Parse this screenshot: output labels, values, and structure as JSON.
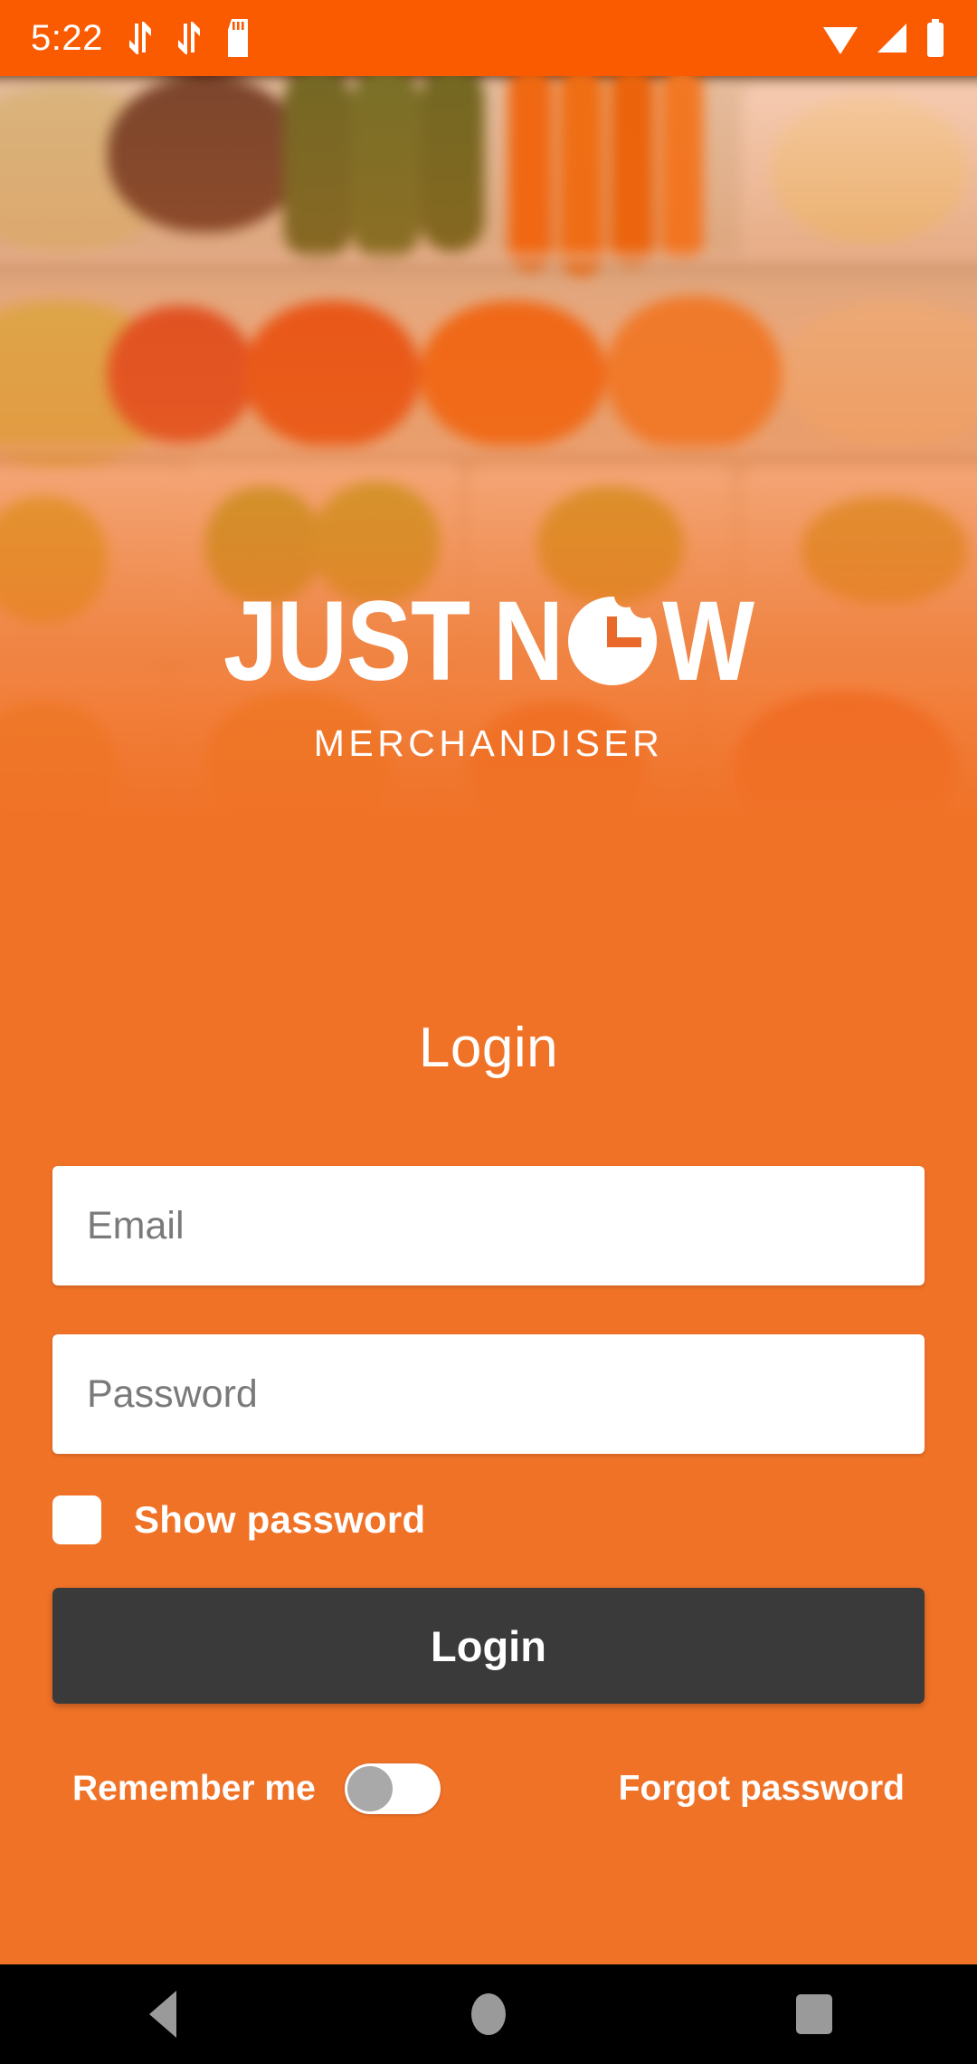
{
  "status_bar": {
    "time": "5:22",
    "left_icons": [
      "data-transfer-icon",
      "data-transfer-icon",
      "sd-card-icon"
    ],
    "right_icons": [
      "wifi-icon",
      "cellular-signal-icon",
      "battery-icon"
    ],
    "background_color": "#FA5A00"
  },
  "brand": {
    "word_one": "JUST",
    "word_two_prefix": "N",
    "word_two_suffix": "W",
    "logo_mark": "clock-bite-icon",
    "full_name": "JUST NOW",
    "subtitle": "MERCHANDISER"
  },
  "theme": {
    "primary_orange": "#F07227",
    "status_orange": "#FA5A00",
    "button_dark": "#3A3A3A",
    "field_white": "#FFFFFF",
    "placeholder_gray": "#7A7A7A",
    "switch_thumb_gray": "#A9A9A9",
    "nav_icon_gray": "#9A9A9A"
  },
  "login": {
    "heading": "Login",
    "email": {
      "placeholder": "Email",
      "value": ""
    },
    "password": {
      "placeholder": "Password",
      "value": ""
    },
    "show_password": {
      "label": "Show password",
      "checked": false
    },
    "submit_label": "Login",
    "remember_me": {
      "label": "Remember me",
      "enabled": false
    },
    "forgot_password_label": "Forgot password"
  },
  "nav_bar": {
    "back": "back-nav-icon",
    "home": "home-nav-icon",
    "recents": "recents-nav-icon"
  }
}
